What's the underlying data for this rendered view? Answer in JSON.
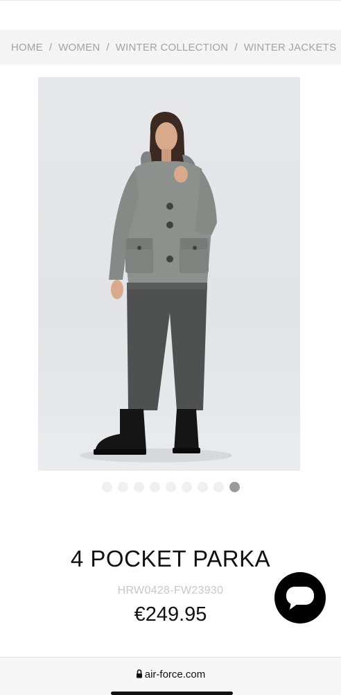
{
  "breadcrumb": {
    "items": [
      "HOME",
      "WOMEN",
      "WINTER COLLECTION",
      "WINTER JACKETS"
    ],
    "separator": "/"
  },
  "product": {
    "image_alt": "4 Pocket Parka worn by model",
    "gallery_total": 9,
    "gallery_active_index": 9,
    "title": "4 POCKET PARKA",
    "sku": "HRW0428-FW23930",
    "price": "€249.95"
  },
  "chat": {
    "icon": "chat-bubble-icon"
  },
  "browser": {
    "url": "air-force.com",
    "lock_icon": "lock-icon"
  },
  "colors": {
    "dot_active": "#9a9a9a",
    "dot_inactive": "#f0f0f0",
    "chat_bg": "#000000"
  }
}
